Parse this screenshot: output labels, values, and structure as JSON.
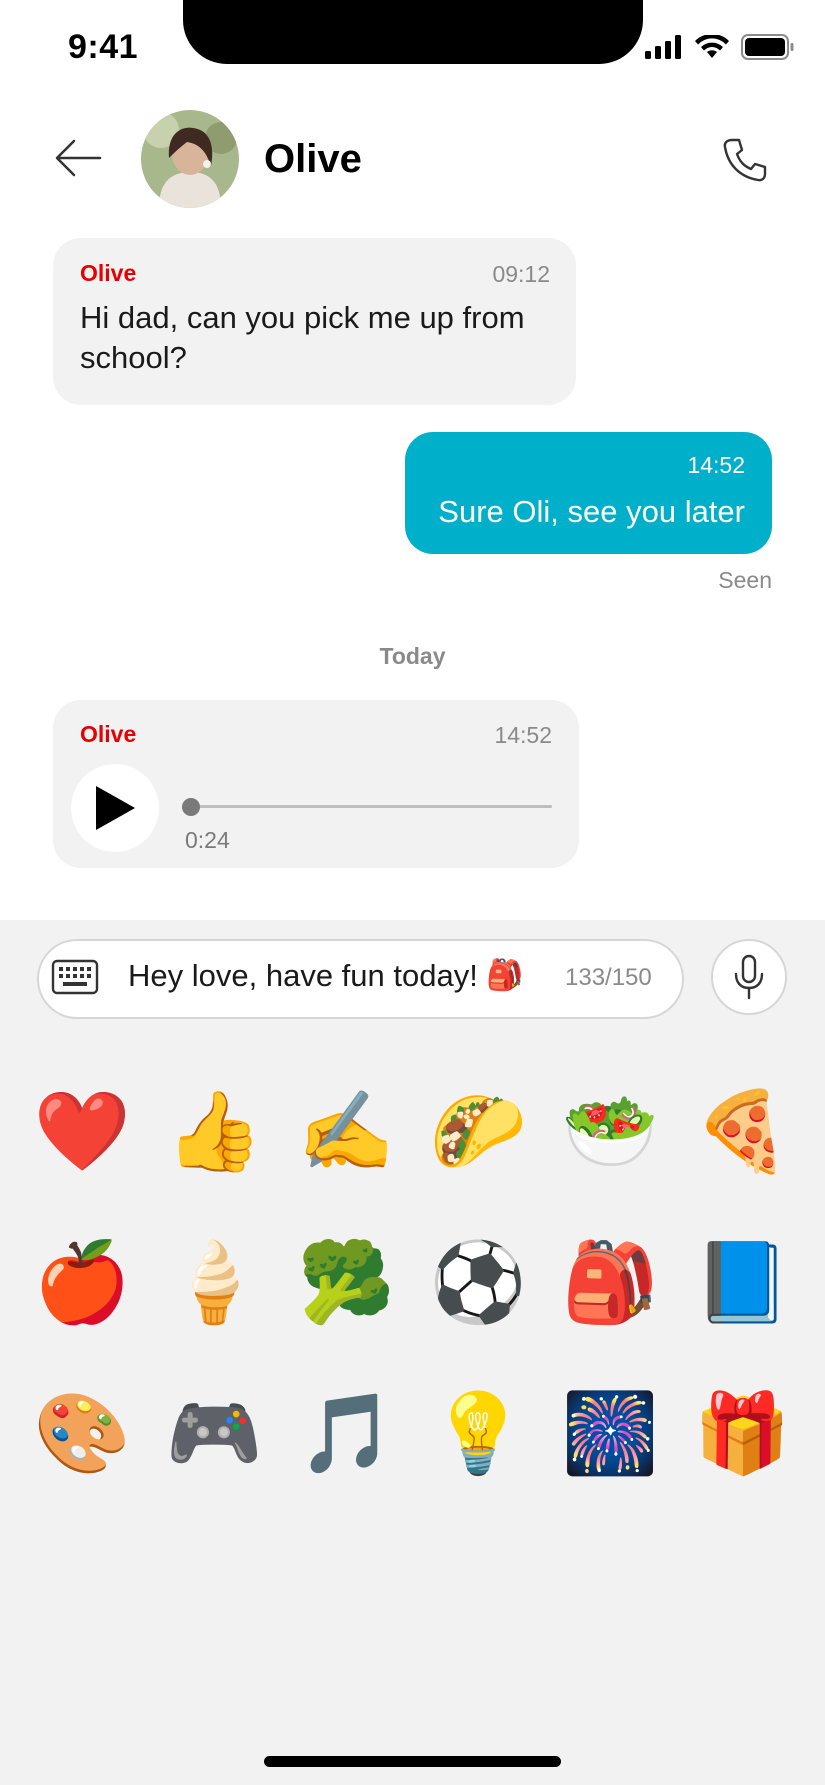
{
  "status_bar": {
    "time": "9:41"
  },
  "header": {
    "contact_name": "Olive"
  },
  "messages": [
    {
      "sender": "Olive",
      "time": "09:12",
      "text": "Hi dad, can you pick me up from school?"
    },
    {
      "time": "14:52",
      "text": "Sure Oli, see you later",
      "status": "Seen"
    }
  ],
  "day_separator": "Today",
  "voice_message": {
    "sender": "Olive",
    "time": "14:52",
    "duration": "0:24",
    "progress": 0.0
  },
  "composer": {
    "text": "Hey love, have fun today!",
    "emoji": "🎒",
    "counter": "133/150"
  },
  "stickers": [
    "❤️",
    "👍",
    "✍️",
    "🌮",
    "🥗",
    "🍕",
    "🍎",
    "🍦",
    "🥦",
    "⚽",
    "🎒",
    "📘",
    "🎨",
    "🎮",
    "🎵",
    "💡",
    "🎆",
    "🎁"
  ],
  "colors": {
    "accent": "#00b0ca",
    "sender": "#e60000",
    "incoming_bubble": "#f2f2f2",
    "panel": "#f2f2f2"
  }
}
